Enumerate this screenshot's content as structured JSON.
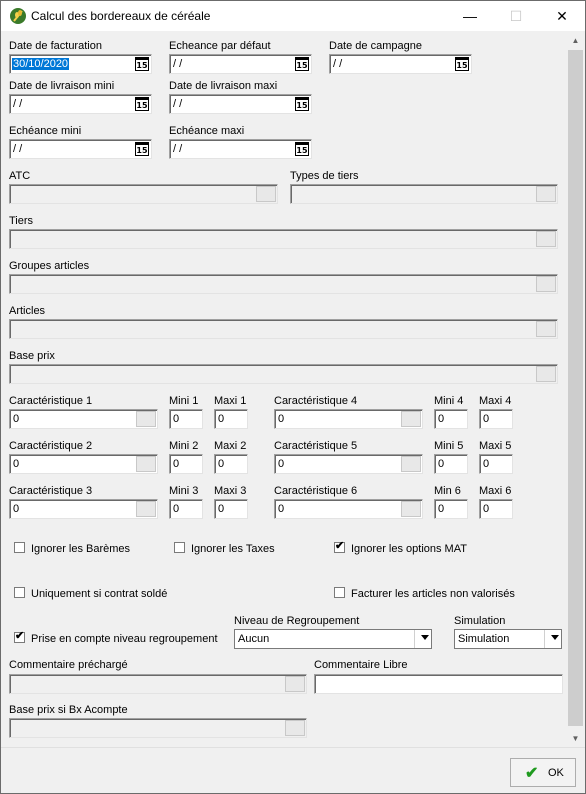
{
  "window": {
    "title": "Calcul des bordereaux de céréale",
    "minimize": "—",
    "maximize": "☐",
    "close": "✕"
  },
  "dates": {
    "facturation": {
      "label": "Date de facturation",
      "value": "30/10/2020"
    },
    "echeance_defaut": {
      "label": "Echeance par défaut",
      "value": " / /"
    },
    "campagne": {
      "label": "Date de campagne",
      "value": " / /"
    },
    "livraison_mini": {
      "label": "Date de livraison mini",
      "value": " / /"
    },
    "livraison_maxi": {
      "label": "Date de livraison maxi",
      "value": " / /"
    },
    "echeance_mini": {
      "label": "Echéance mini",
      "value": " / /"
    },
    "echeance_maxi": {
      "label": "Echéance maxi",
      "value": " / /"
    },
    "cal_icon_text": "15"
  },
  "lookups": {
    "atc": "ATC",
    "types_tiers": "Types de tiers",
    "tiers": "Tiers",
    "groupes_articles": "Groupes articles",
    "articles": "Articles",
    "base_prix": "Base prix"
  },
  "caract": {
    "c1": {
      "label": "Caractéristique 1",
      "value": "0",
      "mini_label": "Mini 1",
      "mini": "0",
      "maxi_label": "Maxi 1",
      "maxi": "0"
    },
    "c2": {
      "label": "Caractéristique 2",
      "value": "0",
      "mini_label": "Mini 2",
      "mini": "0",
      "maxi_label": "Maxi 2",
      "maxi": "0"
    },
    "c3": {
      "label": "Caractéristique 3",
      "value": "0",
      "mini_label": "Mini 3",
      "mini": "0",
      "maxi_label": "Maxi 3",
      "maxi": "0"
    },
    "c4": {
      "label": "Caractéristique 4",
      "value": "0",
      "mini_label": "Mini 4",
      "mini": "0",
      "maxi_label": "Maxi 4",
      "maxi": "0"
    },
    "c5": {
      "label": "Caractéristique 5",
      "value": "0",
      "mini_label": "Mini 5",
      "mini": "0",
      "maxi_label": "Maxi 5",
      "maxi": "0"
    },
    "c6": {
      "label": "Caractéristique 6",
      "value": "0",
      "mini_label": "Min 6",
      "mini": "0",
      "maxi_label": "Maxi 6",
      "maxi": "0"
    }
  },
  "options": {
    "ignorer_baremes": {
      "label": "Ignorer les Barèmes",
      "checked": false
    },
    "ignorer_taxes": {
      "label": "Ignorer les Taxes",
      "checked": false
    },
    "ignorer_mat": {
      "label": "Ignorer les options MAT",
      "checked": true
    },
    "contrat_solde": {
      "label": "Uniquement si contrat soldé",
      "checked": false
    },
    "facturer_non_valorises": {
      "label": "Facturer les articles non valorisés",
      "checked": false
    },
    "prise_en_compte": {
      "label": "Prise en compte niveau regroupement",
      "checked": true
    },
    "check_mark": "✔"
  },
  "niveau": {
    "label": "Niveau de Regroupement",
    "value": "Aucun"
  },
  "simulation": {
    "label": "Simulation",
    "value": "Simulation"
  },
  "commentaire_precharge": {
    "label": "Commentaire préchargé",
    "value": ""
  },
  "commentaire_libre": {
    "label": "Commentaire Libre",
    "value": ""
  },
  "base_prix_acompte": {
    "label": "Base prix si Bx Acompte",
    "value": ""
  },
  "ok_button": {
    "label": "OK",
    "icon": "✔"
  },
  "scroll": {
    "up": "▲",
    "down": "▼"
  }
}
